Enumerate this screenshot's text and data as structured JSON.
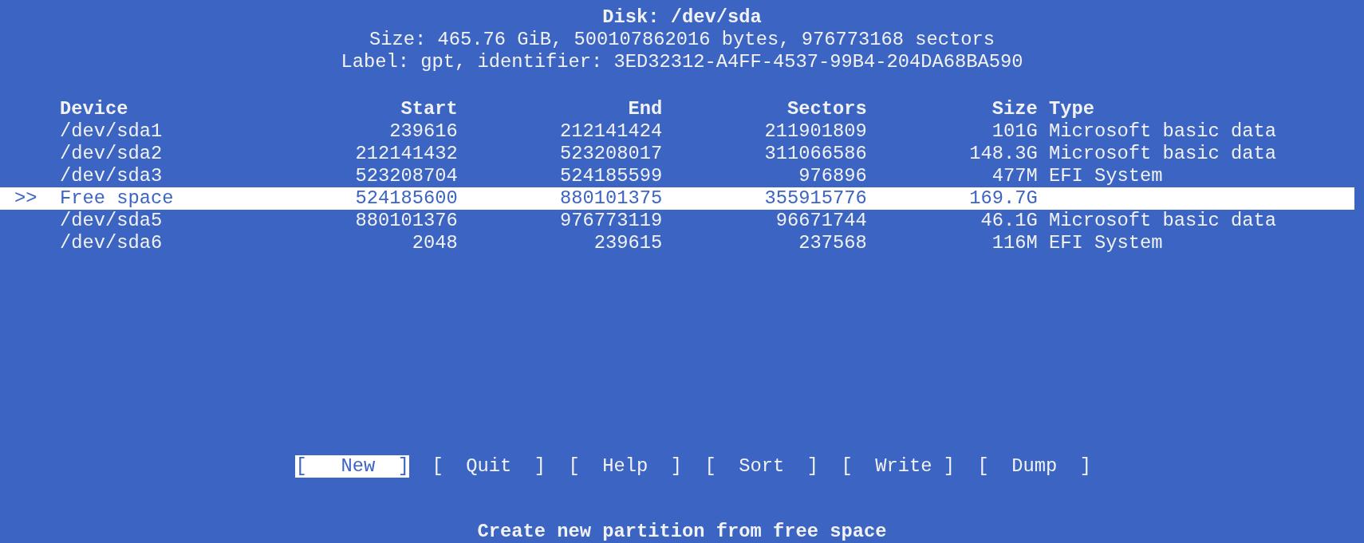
{
  "header": {
    "title": "Disk: /dev/sda",
    "size_line": "Size: 465.76 GiB, 500107862016 bytes, 976773168 sectors",
    "label_line": "Label: gpt, identifier: 3ED32312-A4FF-4537-99B4-204DA68BA590"
  },
  "table": {
    "columns": [
      "Device",
      "Start",
      "End",
      "Sectors",
      "Size",
      "Type"
    ],
    "rows": [
      {
        "selected": false,
        "cells": [
          "/dev/sda1",
          "239616",
          "212141424",
          "211901809",
          "101G",
          "Microsoft basic data"
        ]
      },
      {
        "selected": false,
        "cells": [
          "/dev/sda2",
          "212141432",
          "523208017",
          "311066586",
          "148.3G",
          "Microsoft basic data"
        ]
      },
      {
        "selected": false,
        "cells": [
          "/dev/sda3",
          "523208704",
          "524185599",
          "976896",
          "477M",
          "EFI System"
        ]
      },
      {
        "selected": true,
        "marker": ">>",
        "cells": [
          "Free space",
          "524185600",
          "880101375",
          "355915776",
          "169.7G",
          ""
        ]
      },
      {
        "selected": false,
        "cells": [
          "/dev/sda5",
          "880101376",
          "976773119",
          "96671744",
          "46.1G",
          "Microsoft basic data"
        ]
      },
      {
        "selected": false,
        "cells": [
          "/dev/sda6",
          "2048",
          "239615",
          "237568",
          "116M",
          "EFI System"
        ]
      }
    ]
  },
  "menu": [
    {
      "label": "[   New  ]",
      "selected": true
    },
    {
      "label": "[  Quit  ]",
      "selected": false
    },
    {
      "label": "[  Help  ]",
      "selected": false
    },
    {
      "label": "[  Sort  ]",
      "selected": false
    },
    {
      "label": "[  Write ]",
      "selected": false
    },
    {
      "label": "[  Dump  ]",
      "selected": false
    }
  ],
  "status": "Create new partition from free space"
}
